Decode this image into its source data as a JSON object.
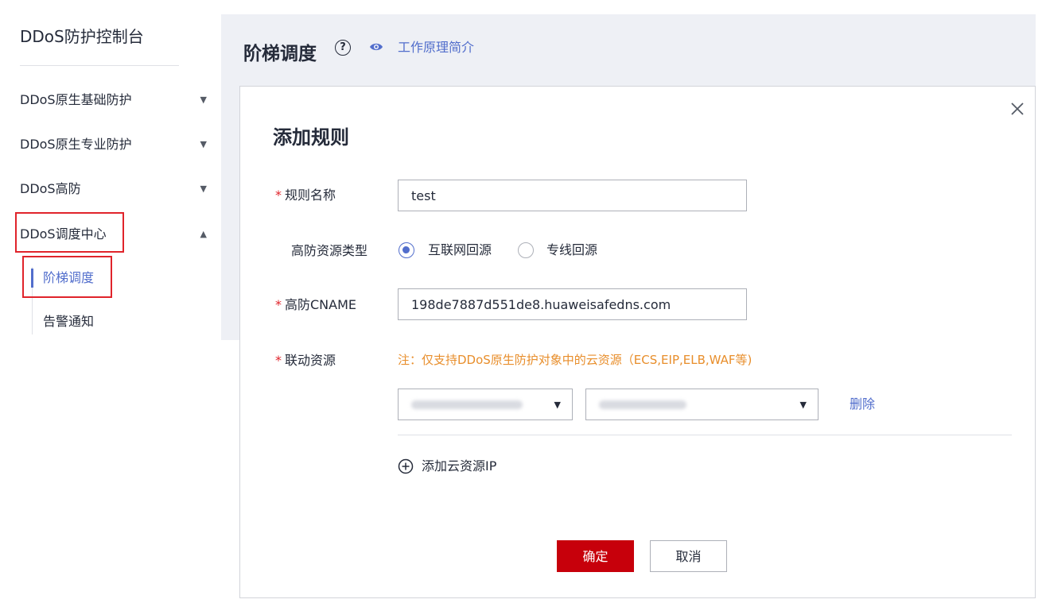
{
  "sidebar": {
    "title": "DDoS防护控制台",
    "items": [
      {
        "label": "DDoS原生基础防护",
        "arrow": "▼"
      },
      {
        "label": "DDoS原生专业防护",
        "arrow": "▼"
      },
      {
        "label": "DDoS高防",
        "arrow": "▼"
      },
      {
        "label": "DDoS调度中心",
        "arrow": "▲"
      }
    ],
    "subitems": [
      {
        "label": "阶梯调度"
      },
      {
        "label": "告警通知"
      }
    ]
  },
  "header": {
    "title": "阶梯调度",
    "help_glyph": "?",
    "intro_link": "工作原理简介"
  },
  "dialog": {
    "title": "添加规则",
    "required_mark": "*",
    "rule_name": {
      "label": "规则名称",
      "value": "test"
    },
    "resource_type": {
      "label": "高防资源类型",
      "options": [
        {
          "label": "互联网回源",
          "checked": true
        },
        {
          "label": "专线回源",
          "checked": false
        }
      ]
    },
    "cname": {
      "label": "高防CNAME",
      "value": "198de7887d551de8.huaweisafedns.com"
    },
    "linked_resource": {
      "label": "联动资源",
      "note": "注：仅支持DDoS原生防护对象中的云资源（ECS,EIP,ELB,WAF等)",
      "delete_label": "删除",
      "caret": "▼"
    },
    "add_ip_label": "添加云资源IP",
    "confirm_label": "确定",
    "cancel_label": "取消"
  },
  "colors": {
    "accent": "#526ecc",
    "required": "#e0242b",
    "note": "#e88e2b",
    "primary_button": "#c7000b",
    "highlight_box": "#e0242b"
  }
}
